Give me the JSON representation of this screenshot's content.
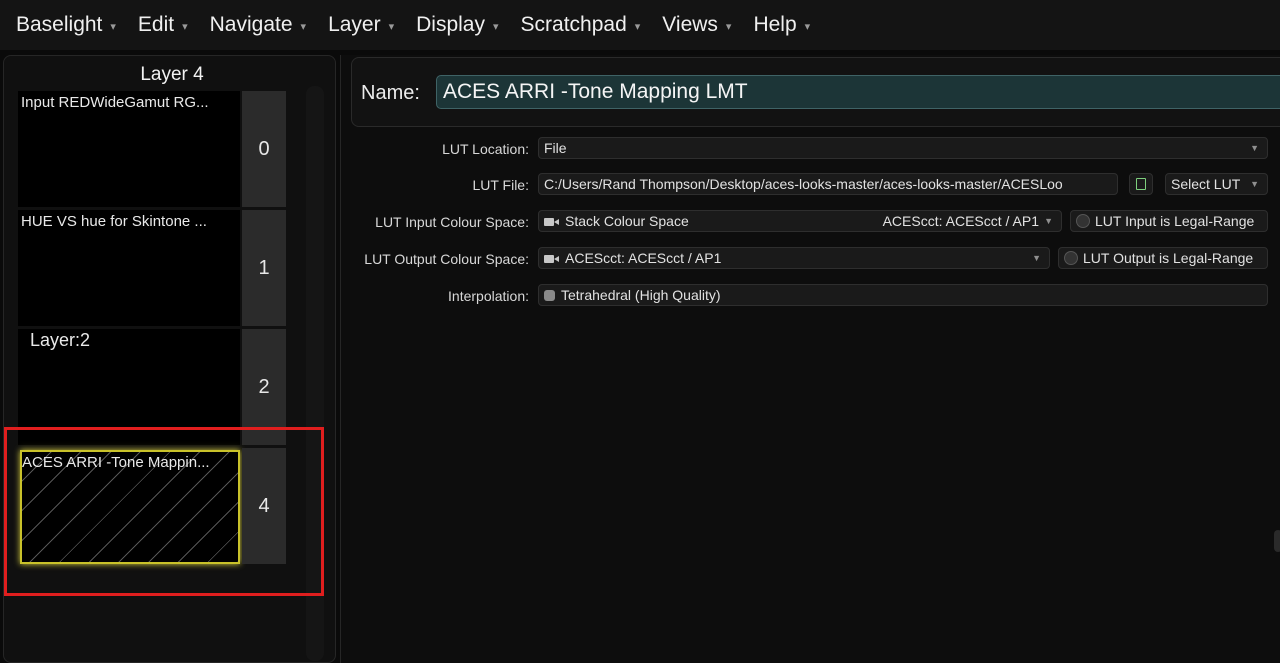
{
  "menubar": {
    "items": [
      "Baselight",
      "Edit",
      "Navigate",
      "Layer",
      "Display",
      "Scratchpad",
      "Views",
      "Help"
    ],
    "arrow": "▾"
  },
  "stack": {
    "title": "Layer 4",
    "layers": [
      {
        "label": "Input REDWideGamut RG...",
        "number": "0"
      },
      {
        "label": "HUE VS hue for Skintone ...",
        "number": "1"
      },
      {
        "label": "Layer:2",
        "number": "2"
      },
      {
        "label": "ACES ARRI -Tone Mappin...",
        "number": "4"
      }
    ],
    "highlight_color": "#e01e1e",
    "selected_color": "#c9c22a"
  },
  "editor": {
    "name_label": "Name:",
    "name_value": "ACES ARRI -Tone Mapping LMT",
    "lut_location": {
      "label": "LUT Location:",
      "value": "File"
    },
    "lut_file": {
      "label": "LUT File:",
      "value": "C:/Users/Rand Thompson/Desktop/aces-looks-master/aces-looks-master/ACESLoo",
      "file_icon": "file-icon",
      "select_button": "Select LUT"
    },
    "lut_input": {
      "label": "LUT Input Colour Space:",
      "value": "Stack Colour Space",
      "secondary": "ACEScct: ACEScct / AP1",
      "toggle": "LUT Input is Legal-Range"
    },
    "lut_output": {
      "label": "LUT Output Colour Space:",
      "value": "ACEScct: ACEScct / AP1",
      "toggle": "LUT Output is Legal-Range"
    },
    "interpolation": {
      "label": "Interpolation:",
      "value": "Tetrahedral (High Quality)"
    }
  }
}
